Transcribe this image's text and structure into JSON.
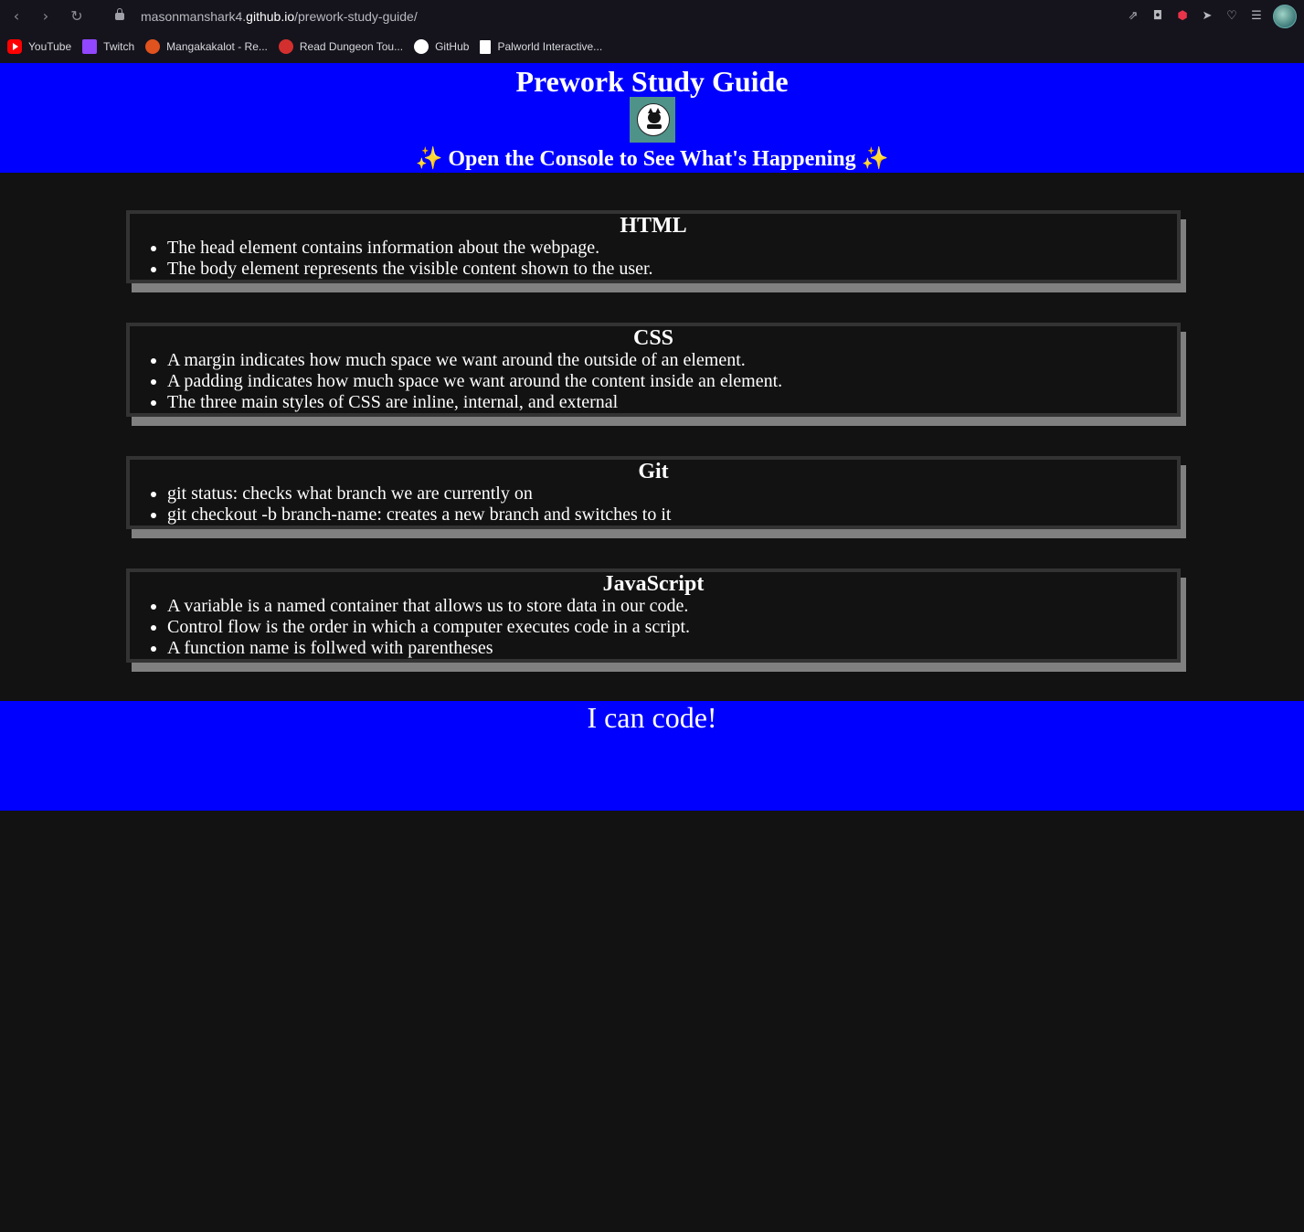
{
  "browser": {
    "url_prefix": "masonmanshark4.",
    "url_host": "github.io",
    "url_path": "/prework-study-guide/",
    "bookmarks": [
      {
        "label": "YouTube",
        "icon": "youtube-icon"
      },
      {
        "label": "Twitch",
        "icon": "twitch-icon"
      },
      {
        "label": "Mangakakalot - Re...",
        "icon": "mangakakalot-icon"
      },
      {
        "label": "Read Dungeon Tou...",
        "icon": "manga-reader-icon"
      },
      {
        "label": "GitHub",
        "icon": "github-icon"
      },
      {
        "label": "Palworld Interactive...",
        "icon": "document-icon"
      }
    ]
  },
  "header": {
    "title": "Prework Study Guide",
    "subtitle": "✨ Open the Console to See What's Happening ✨",
    "logo_icon": "cat-logo-icon"
  },
  "sections": [
    {
      "title": "HTML",
      "items": [
        "The head element contains information about the webpage.",
        "The body element represents the visible content shown to the user."
      ]
    },
    {
      "title": "CSS",
      "items": [
        "A margin indicates how much space we want around the outside of an element.",
        "A padding indicates how much space we want around the content inside an element.",
        "The three main styles of CSS are inline, internal, and external"
      ]
    },
    {
      "title": "Git",
      "items": [
        "git status: checks what branch we are currently on",
        "git checkout -b branch-name: creates a new branch and switches to it"
      ]
    },
    {
      "title": "JavaScript",
      "items": [
        "A variable is a named container that allows us to store data in our code.",
        "Control flow is the order in which a computer executes code in a script.",
        "A function name is follwed with parentheses"
      ]
    }
  ],
  "footer": {
    "text": "I can code!"
  },
  "colors": {
    "band": "#0000ff",
    "page_bg": "#121212",
    "card_border": "#333333",
    "card_shadow": "#808080",
    "logo_bg": "#4e9289"
  }
}
